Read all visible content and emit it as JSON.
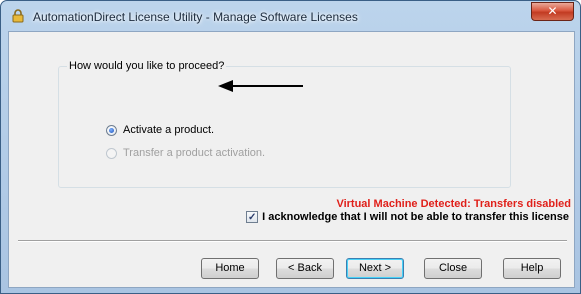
{
  "window": {
    "title": "AutomationDirect License Utility - Manage Software Licenses",
    "close_label": "✕"
  },
  "group": {
    "legend": "How would you like to proceed?",
    "options": [
      {
        "label": "Activate a product.",
        "checked": true,
        "enabled": true
      },
      {
        "label": "Transfer a product activation.",
        "checked": false,
        "enabled": false
      }
    ]
  },
  "warning": {
    "text": "Virtual Machine Detected: Transfers disabled",
    "color": "#e0201a"
  },
  "acknowledge": {
    "label": "I acknowledge that I will not be able to transfer this license",
    "checked": true
  },
  "buttons": {
    "home": "Home",
    "back": "< Back",
    "next": "Next >",
    "close": "Close",
    "help": "Help"
  },
  "icons": {
    "title": "lock-icon",
    "annotation": "arrow-left-icon"
  }
}
